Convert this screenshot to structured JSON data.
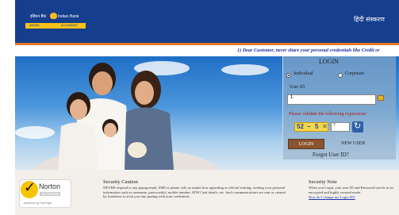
{
  "header": {
    "logo_text": "इंडियन बैंक",
    "logo_bank_name": "Indian Bank",
    "logo_tagline_left": "इलाहाबाद",
    "logo_tagline_right": "ALLAHABAD",
    "language_link": "हिंदी संस्करण"
  },
  "ticker": {
    "text": "1) Dear Customer, never share your personal credentials like Credit or"
  },
  "login": {
    "title": "LOGIN",
    "option_individual": "Individual",
    "option_corporate": "Corporate",
    "selected_option": "Individual",
    "userid_label": "User ID",
    "userid_value": "1",
    "validate_label": "Please validate the following expression:",
    "captcha": {
      "a": "52",
      "op": "−",
      "b": "5",
      "eq": "=",
      "answer": "?"
    },
    "login_button": "LOGIN",
    "new_user_link": "NEW USER",
    "forgot_link": "Forgot User ID?"
  },
  "footer": {
    "norton_name": "Norton",
    "norton_secured": "SECURED",
    "norton_powered": "powered by VeriSign",
    "caution_title": "Security Caution",
    "caution_body": "NEVER respond to any popup,email, SMS or phone call, no matter how appealing or official looking, seeking your personal information such as username, password(s), mobile number, ATM Card details, etc. Such communications are sent or created by fraudsters to trick you into parting with your credentials.",
    "note_title": "Security Note",
    "note_body": "When you Login, your user ID and Password travels in an encrypted and highly secured mode.",
    "note_link": "How do I change my Login ID?"
  },
  "colors": {
    "header_blue": "#153e8c",
    "accent_orange": "#e87722",
    "ticker_text": "#1d2fa8",
    "login_button": "#8a5431",
    "captcha_bg": "#f4d64a",
    "validate_label": "#b01818"
  },
  "icons": {
    "keyboard": "virtual-keyboard-icon",
    "refresh": "refresh-icon",
    "norton": "norton-checkmark-icon"
  }
}
